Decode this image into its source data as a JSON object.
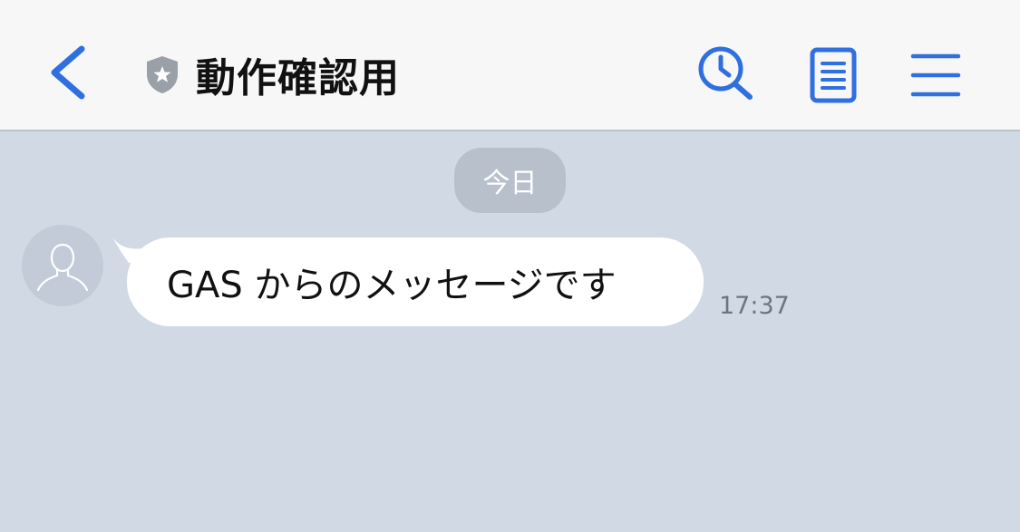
{
  "header": {
    "title": "動作確認用",
    "icons": {
      "back": "chevron-left-icon",
      "badge": "shield-star-icon",
      "search": "clock-search-icon",
      "notes": "notes-icon",
      "menu": "hamburger-menu-icon"
    },
    "accent_color": "#2f6fe0"
  },
  "chat": {
    "date_label": "今日",
    "messages": [
      {
        "text": "GAS からのメッセージです",
        "time": "17:37",
        "sender_avatar": "default-user-avatar-icon"
      }
    ],
    "background_color": "#d1d9e4"
  }
}
